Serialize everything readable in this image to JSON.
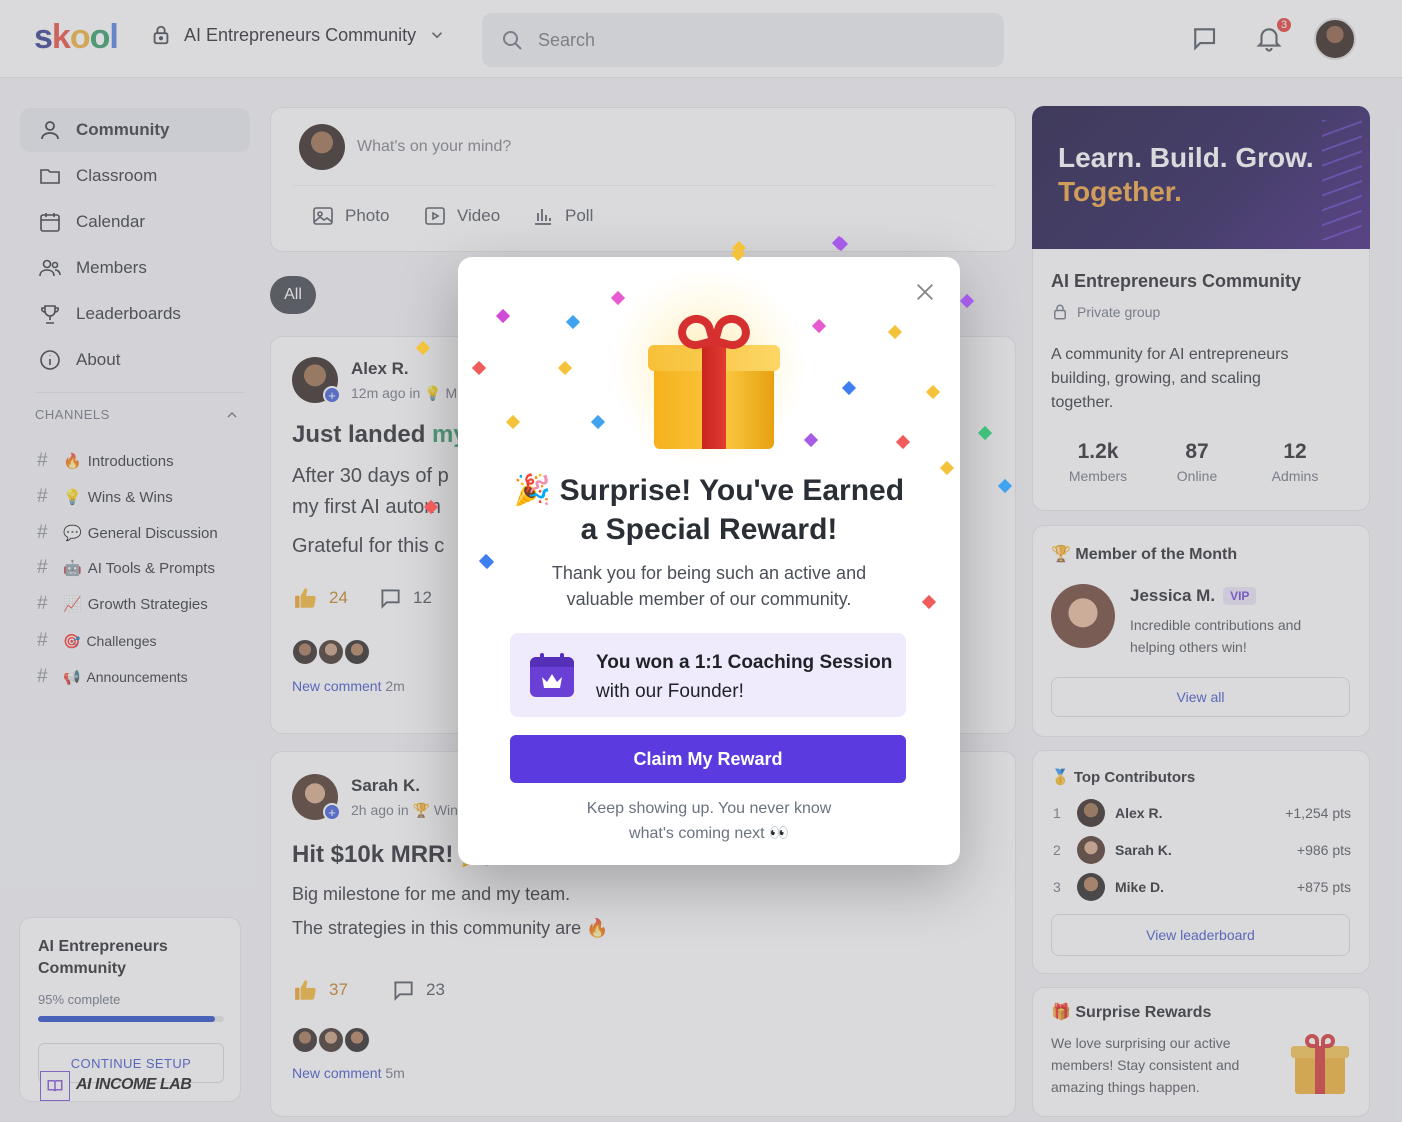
{
  "header": {
    "logo_letters": [
      "s",
      "k",
      "o",
      "o",
      "l"
    ],
    "community_name": "AI Entrepreneurs Community",
    "search_placeholder": "Search",
    "notification_count": "3"
  },
  "sidebar": {
    "nav": [
      {
        "label": "Community",
        "icon": "people-icon"
      },
      {
        "label": "Classroom",
        "icon": "folder-icon"
      },
      {
        "label": "Calendar",
        "icon": "calendar-icon"
      },
      {
        "label": "Members",
        "icon": "members-icon"
      },
      {
        "label": "Leaderboards",
        "icon": "trophy-icon"
      },
      {
        "label": "About",
        "icon": "info-icon"
      }
    ],
    "channels_heading": "CHANNELS",
    "channels": [
      {
        "emoji": "🔥",
        "label": "Introductions"
      },
      {
        "emoji": "💡",
        "label": "Wins & Wins"
      },
      {
        "emoji": "💬",
        "label": "General Discussion"
      },
      {
        "emoji": "🤖",
        "label": "AI Tools & Prompts"
      },
      {
        "emoji": "📈",
        "label": "Growth Strategies"
      },
      {
        "emoji": "🎯",
        "label": "Challenges"
      },
      {
        "emoji": "📢",
        "label": "Announcements"
      }
    ],
    "setup": {
      "title": "AI Entrepreneurs Community",
      "progress_label": "95% complete",
      "progress": 0.95,
      "button": "CONTINUE SETUP",
      "watermark": "AI INCOME LAB"
    }
  },
  "composer": {
    "placeholder": "What's on your mind?",
    "actions": [
      "Photo",
      "Video",
      "Poll"
    ]
  },
  "filter": {
    "all": "All"
  },
  "posts": [
    {
      "author": "Alex R.",
      "meta": "12m ago in 💡 M",
      "title_a": "Just landed ",
      "title_b": "my",
      "line1": "After 30 days of p",
      "line2": "my first AI autom",
      "line3": "Grateful for this c",
      "likes": "24",
      "comments": "12",
      "new_comment": "New comment",
      "new_comment_time": "2m"
    },
    {
      "author": "Sarah K.",
      "meta": "2h ago in 🏆 Win",
      "title": "Hit $10k MRR! 🎉",
      "line1": "Big milestone for me and my team.",
      "line2": "The strategies in this community are 🔥",
      "likes": "37",
      "comments": "23",
      "new_comment": "New comment",
      "new_comment_time": "5m"
    }
  ],
  "right": {
    "banner_line1": "Learn. Build. Grow.",
    "banner_line2": "Together.",
    "group_name": "AI Entrepreneurs Community",
    "group_type": "Private group",
    "description": "A community for AI entrepreneurs building, growing, and scaling together.",
    "stats": [
      {
        "value": "1.2k",
        "label": "Members"
      },
      {
        "value": "87",
        "label": "Online"
      },
      {
        "value": "12",
        "label": "Admins"
      }
    ],
    "motm": {
      "heading": "🏆 Member of the Month",
      "name": "Jessica M.",
      "badge": "VIP",
      "text": "Incredible contributions and helping others win!",
      "button": "View all"
    },
    "contributors": {
      "heading": "🥇 Top Contributors",
      "rows": [
        {
          "rank": "1",
          "name": "Alex R.",
          "points": "+1,254 pts"
        },
        {
          "rank": "2",
          "name": "Sarah K.",
          "points": "+986 pts"
        },
        {
          "rank": "3",
          "name": "Mike D.",
          "points": "+875 pts"
        }
      ],
      "button": "View leaderboard"
    },
    "surprise": {
      "heading": "🎁 Surprise Rewards",
      "text": "We love surprising our active members! Stay consistent and amazing things happen."
    }
  },
  "modal": {
    "title_line1": "🎉 Surprise! You've Earned",
    "title_line2": "a Special Reward!",
    "body_line1": "Thank you for being such an active and",
    "body_line2": "valuable member of our community.",
    "reward_line1": "You won a 1:1 Coaching Session",
    "reward_line2": "with our Founder!",
    "cta": "Claim My Reward",
    "footer_line1": "Keep showing up. You never know",
    "footer_line2": "what's coming next 👀"
  },
  "colors": {
    "accent": "#5b3be0",
    "link": "#3a50c8",
    "banner_text": "#f2a13a"
  }
}
